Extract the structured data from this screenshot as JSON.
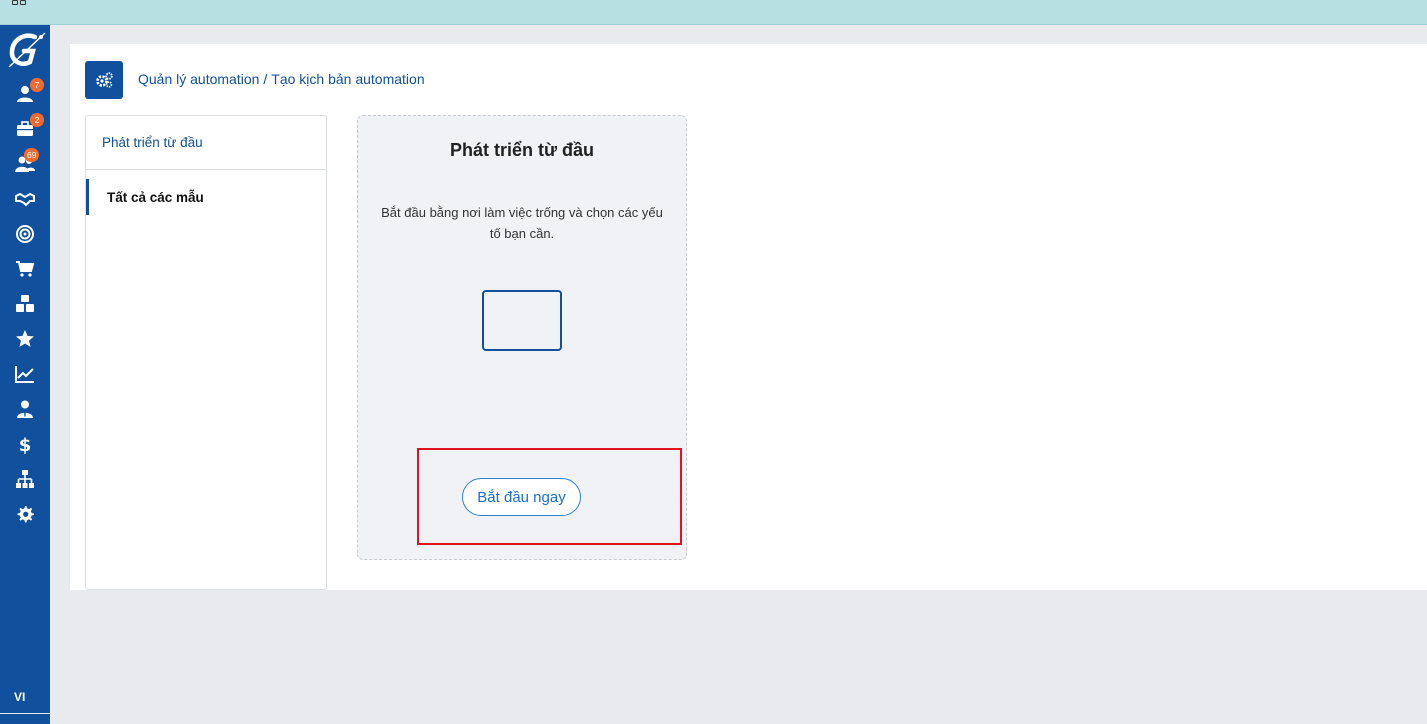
{
  "sidebar": {
    "language": "VI",
    "badges": {
      "contacts": "7",
      "deals": "2",
      "groups": "69"
    },
    "icons": [
      "user-icon",
      "briefcase-icon",
      "users-icon",
      "handshake-icon",
      "target-icon",
      "cart-icon",
      "cubes-icon",
      "star-icon",
      "chart-line-icon",
      "user-tie-icon",
      "dollar-icon",
      "sitemap-icon",
      "gear-icon"
    ]
  },
  "header": {
    "breadcrumb_parent": "Quản lý automation",
    "breadcrumb_separator": "/",
    "breadcrumb_current": "Tạo kịch bản automation"
  },
  "left_panel": {
    "items": [
      {
        "label": "Phát triển từ đầu"
      },
      {
        "label": "Tất cả các mẫu"
      }
    ]
  },
  "template_card": {
    "title": "Phát triển từ đầu",
    "description": "Bắt đầu bằng nơi làm việc trống và chọn các yếu tố bạn cần.",
    "button_label": "Bắt đầu ngay"
  },
  "colors": {
    "brand": "#10509c",
    "topbar": "#b7e0e3",
    "badge": "#f26b2e",
    "highlight": "#e0141e"
  }
}
